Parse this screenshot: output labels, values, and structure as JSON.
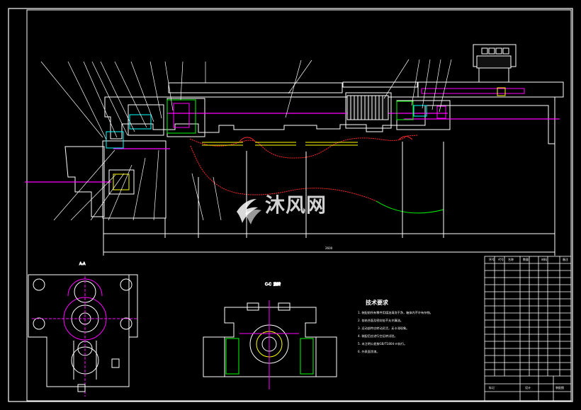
{
  "sheet": {
    "background": "#000000",
    "frame_color": "#ffffff",
    "accent_colors": {
      "white": "#ffffff",
      "magenta": "#ff00ff",
      "cyan": "#00ffff",
      "red": "#ff2a2a",
      "green": "#00ff00",
      "yellow": "#ffff00",
      "blue": "#6fa8ff"
    }
  },
  "labels": {
    "top_section": "A-A",
    "middle_section": "C-C",
    "middle_section_suffix": "旋转",
    "tech_title": "技术要求",
    "tech_lines": [
      "1. 装配前所有零件用煤油清洗干净，箱体内不许有杂物。",
      "2. 各结合面及密封处不允许漏油。",
      "3. 运动部件应转动灵活，无卡滞现象。",
      "4. 装配后应进行空运转试验。",
      "5. 未注明公差按GB/T1804-m执行。",
      "6. 外表面涂漆。"
    ],
    "dimension_overall": "2600"
  },
  "title_block": {
    "headers": [
      "序号",
      "代号",
      "名称",
      "数量",
      "材料",
      "备注"
    ],
    "bottom_left": "标记",
    "bottom_mid": "设计",
    "bottom_right": "装配图"
  },
  "watermark": {
    "brand": "沐风网",
    "icon_name": "watermark-logo-icon"
  }
}
